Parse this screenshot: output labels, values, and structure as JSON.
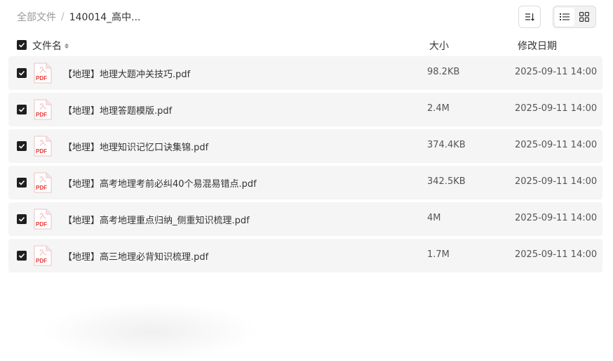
{
  "breadcrumb": {
    "root": "全部文件",
    "separator": "/",
    "current": "140014_高中..."
  },
  "columns": {
    "name": "文件名",
    "size": "大小",
    "date": "修改日期"
  },
  "toolbar": {
    "sort_icon": "sort-icon",
    "list_view_icon": "list-view-icon",
    "grid_view_icon": "grid-view-icon",
    "active_view": "list"
  },
  "files": [
    {
      "name": "【地理】地理大题冲关技巧.pdf",
      "size": "98.2KB",
      "date": "2025-09-11 14:00",
      "checked": true,
      "icon": "pdf-icon"
    },
    {
      "name": "【地理】地理答题模版.pdf",
      "size": "2.4M",
      "date": "2025-09-11 14:00",
      "checked": true,
      "icon": "pdf-icon"
    },
    {
      "name": "【地理】地理知识记忆口诀集锦.pdf",
      "size": "374.4KB",
      "date": "2025-09-11 14:00",
      "checked": true,
      "icon": "pdf-icon"
    },
    {
      "name": "【地理】高考地理考前必纠40个易混易错点.pdf",
      "size": "342.5KB",
      "date": "2025-09-11 14:00",
      "checked": true,
      "icon": "pdf-icon"
    },
    {
      "name": "【地理】高考地理重点归纳_侧重知识梳理.pdf",
      "size": "4M",
      "date": "2025-09-11 14:00",
      "checked": true,
      "icon": "pdf-icon"
    },
    {
      "name": "【地理】高三地理必背知识梳理.pdf",
      "size": "1.7M",
      "date": "2025-09-11 14:00",
      "checked": true,
      "icon": "pdf-icon"
    }
  ],
  "colors": {
    "row_bg": "#f5f5f5",
    "pdf_red": "#e53935",
    "checkbox": "#1f1f1f"
  }
}
